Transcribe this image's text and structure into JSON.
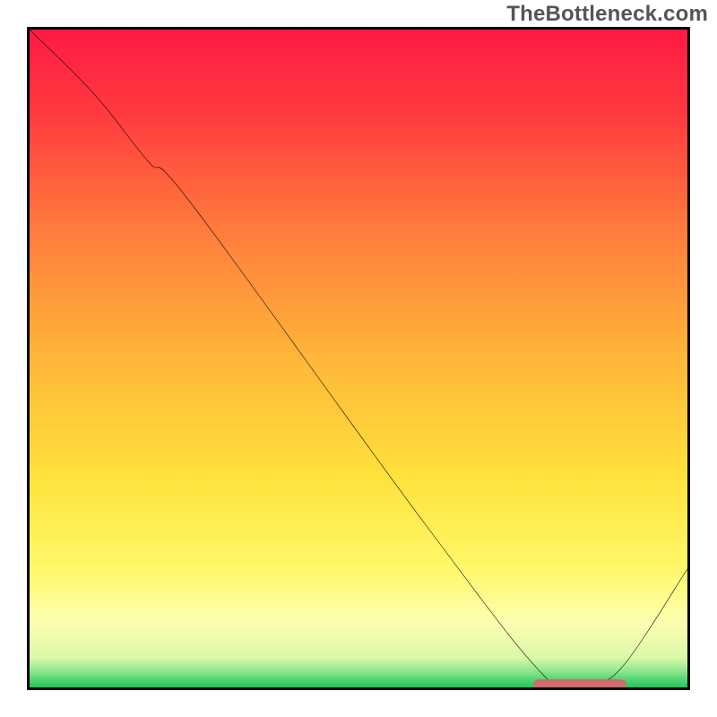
{
  "watermark": "TheBottleneck.com",
  "chart_data": {
    "type": "line",
    "title": "",
    "xlabel": "",
    "ylabel": "",
    "xlim": [
      0,
      100
    ],
    "ylim": [
      0,
      100
    ],
    "grid": false,
    "series": [
      {
        "name": "bottleneck-curve",
        "x": [
          0,
          10,
          18,
          25,
          60,
          79,
          85,
          90,
          100
        ],
        "values": [
          100,
          90,
          80,
          73,
          25,
          1,
          1,
          3,
          18
        ]
      }
    ],
    "annotations": [
      {
        "name": "optimal-range-marker",
        "x_start": 76,
        "x_end": 90,
        "y": 1
      }
    ],
    "background_gradient": {
      "type": "vertical",
      "stops": [
        {
          "pos": 0.0,
          "color": "#ff1a44"
        },
        {
          "pos": 0.13,
          "color": "#ff3b3f"
        },
        {
          "pos": 0.3,
          "color": "#ff7a3c"
        },
        {
          "pos": 0.5,
          "color": "#ffb63a"
        },
        {
          "pos": 0.68,
          "color": "#ffe23c"
        },
        {
          "pos": 0.82,
          "color": "#fff86a"
        },
        {
          "pos": 0.9,
          "color": "#fdffb0"
        },
        {
          "pos": 0.955,
          "color": "#d9f8a8"
        },
        {
          "pos": 0.975,
          "color": "#8fe68e"
        },
        {
          "pos": 1.0,
          "color": "#1fc659"
        }
      ]
    }
  }
}
